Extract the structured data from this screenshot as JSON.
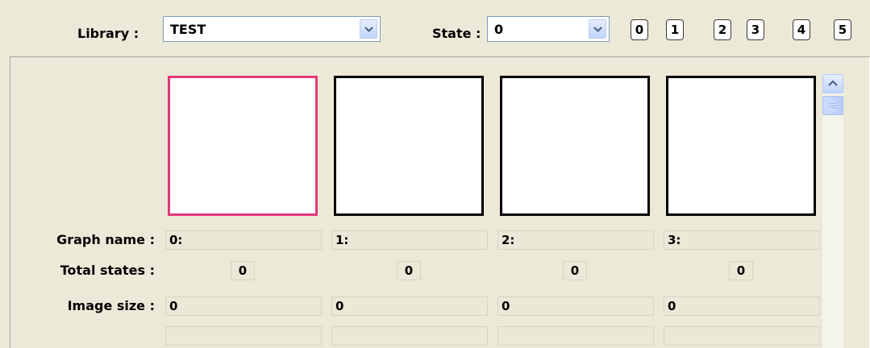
{
  "library": {
    "label": "Library :",
    "value": "TEST"
  },
  "state": {
    "label": "State :",
    "value": "0"
  },
  "state_buttons": [
    "0",
    "1",
    "2",
    "3",
    "4",
    "5"
  ],
  "rows": {
    "graph_name_label": "Graph name :",
    "total_states_label": "Total states :",
    "image_size_label": "Image size :"
  },
  "graphs": [
    {
      "name": "0:",
      "total_states": "0",
      "image_size": "0",
      "extra": ""
    },
    {
      "name": "1:",
      "total_states": "0",
      "image_size": "0",
      "extra": ""
    },
    {
      "name": "2:",
      "total_states": "0",
      "image_size": "0",
      "extra": ""
    },
    {
      "name": "3:",
      "total_states": "0",
      "image_size": "0",
      "extra": ""
    }
  ],
  "colors": {
    "selected_border": "#e3387a",
    "background": "#ece9d8"
  },
  "icons": {
    "combo_arrow": "chevron-down-icon",
    "scroll_up": "chevron-up-icon"
  }
}
